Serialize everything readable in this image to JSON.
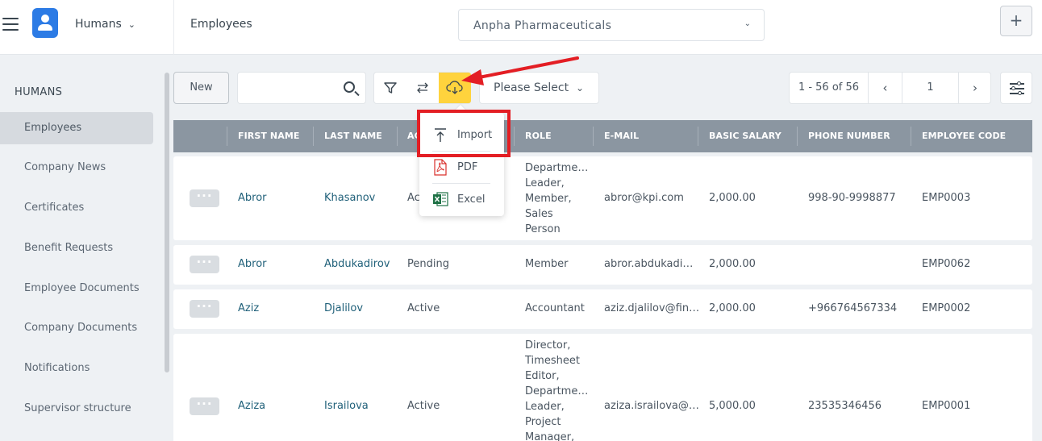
{
  "topbar": {
    "module": "Humans",
    "page_title": "Employees",
    "company": "Anpha Pharmaceuticals",
    "add_label": "+"
  },
  "sidebar": {
    "title": "HUMANS",
    "items": [
      {
        "label": "Employees",
        "active": true
      },
      {
        "label": "Company News"
      },
      {
        "label": "Certificates"
      },
      {
        "label": "Benefit Requests"
      },
      {
        "label": "Employee Documents"
      },
      {
        "label": "Company Documents"
      },
      {
        "label": "Notifications"
      },
      {
        "label": "Supervisor structure"
      }
    ]
  },
  "toolbar": {
    "new_label": "New",
    "search_placeholder": "",
    "select_label": "Please Select",
    "pager_range": "1 - 56 of 56",
    "page": "1"
  },
  "export_menu": {
    "items": [
      {
        "label": "Import",
        "icon": "upload-icon"
      },
      {
        "label": "PDF",
        "icon": "pdf-file-icon"
      },
      {
        "label": "Excel",
        "icon": "excel-file-icon"
      }
    ]
  },
  "table": {
    "columns": [
      "FIRST NAME",
      "LAST NAME",
      "AC",
      "ROLE",
      "E-MAIL",
      "BASIC SALARY",
      "PHONE NUMBER",
      "EMPLOYEE CODE"
    ],
    "rows": [
      {
        "first": "Abror",
        "last": "Khasanov",
        "status": "Ac",
        "role": [
          "Departme…",
          "Leader,",
          "Member,",
          "Sales",
          "Person"
        ],
        "email": "abror@kpi.com",
        "salary": "2,000.00",
        "phone": "998-90-9998877",
        "code": "EMP0003"
      },
      {
        "first": "Abror",
        "last": "Abdukadirov",
        "status": "Pending",
        "role": [
          "Member"
        ],
        "email": "abror.abdukadi…",
        "salary": "2,000.00",
        "phone": "",
        "code": "EMP0062"
      },
      {
        "first": "Aziz",
        "last": "Djalilov",
        "status": "Active",
        "role": [
          "Accountant"
        ],
        "email": "aziz.djalilov@fin…",
        "salary": "2,000.00",
        "phone": "+966764567334",
        "code": "EMP0002"
      },
      {
        "first": "Aziza",
        "last": "Israilova",
        "status": "Active",
        "role": [
          "Director,",
          "Timesheet",
          "Editor,",
          "Departme…",
          "Leader,",
          "Project",
          "Manager,"
        ],
        "email": "aziza.israilova@…",
        "salary": "5,000.00",
        "phone": "23535346456",
        "code": "EMP0001"
      }
    ]
  },
  "colors": {
    "accent": "#ffd33d",
    "header": "#8b96a1",
    "link": "#21617a",
    "annotation": "#e31e24",
    "brand": "#2c7be5"
  }
}
